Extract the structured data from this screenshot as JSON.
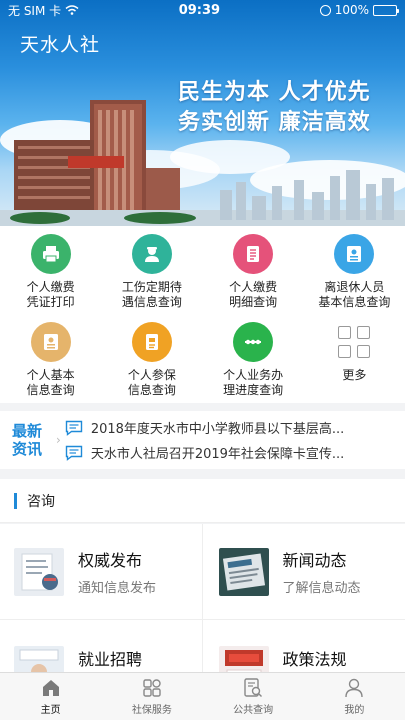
{
  "status_bar": {
    "carrier": "无 SIM 卡",
    "time": "09:39",
    "battery": "100%"
  },
  "header": {
    "title": "天水人社"
  },
  "banner": {
    "slogan_line1": "民生为本 人才优先",
    "slogan_line2": "务实创新 廉洁高效"
  },
  "quick_actions": [
    {
      "label": "个人缴费\n凭证打印",
      "icon": "printer-icon",
      "color": "#3bb36b"
    },
    {
      "label": "工伤定期待\n遇信息查询",
      "icon": "worker-icon",
      "color": "#2fb39a"
    },
    {
      "label": "个人缴费\n明细查询",
      "icon": "document-list-icon",
      "color": "#e5527a"
    },
    {
      "label": "离退休人员\n基本信息查询",
      "icon": "id-card-icon",
      "color": "#3aa5e6"
    },
    {
      "label": "个人基本\n信息查询",
      "icon": "id-card-icon",
      "color": "#e5b46b"
    },
    {
      "label": "个人参保\n信息查询",
      "icon": "insurance-doc-icon",
      "color": "#f0a224"
    },
    {
      "label": "个人业务办\n理进度查询",
      "icon": "progress-icon",
      "color": "#2ab34c"
    },
    {
      "label": "更多",
      "icon": "grid-more-icon",
      "color": "#999999"
    }
  ],
  "news": {
    "badge_line1": "最新",
    "badge_line2": "资讯",
    "items": [
      "2018年度天水市中小学教师县以下基层高...",
      "天水市人社局召开2019年社会保障卡宣传..."
    ]
  },
  "consult": {
    "section_title": "咨询",
    "items": [
      {
        "title": "权威发布",
        "subtitle": "通知信息发布"
      },
      {
        "title": "新闻动态",
        "subtitle": "了解信息动态"
      },
      {
        "title": "就业招聘",
        "subtitle": ""
      },
      {
        "title": "政策法规",
        "subtitle": ""
      }
    ]
  },
  "tabs": [
    {
      "label": "主页",
      "icon": "home-icon"
    },
    {
      "label": "社保服务",
      "icon": "grid-icon"
    },
    {
      "label": "公共查询",
      "icon": "search-doc-icon"
    },
    {
      "label": "我的",
      "icon": "person-icon"
    }
  ],
  "colors": {
    "accent": "#1f8ad8",
    "active_tab": "#111111"
  }
}
